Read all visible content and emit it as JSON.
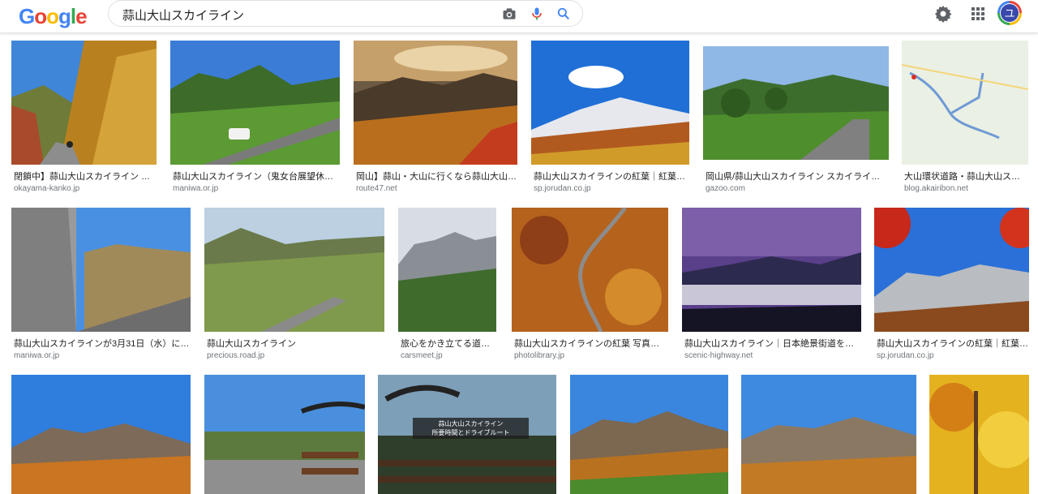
{
  "header": {
    "logo_letters": [
      "G",
      "o",
      "o",
      "g",
      "l",
      "e"
    ],
    "search_query": "蒜山大山スカイライン",
    "avatar_initial": "ユ",
    "icons": [
      "camera-icon",
      "mic-icon",
      "search-icon",
      "gear-icon",
      "apps-icon"
    ]
  },
  "colors": {
    "blue": "#4285f4",
    "red": "#ea4335",
    "yellow": "#fbbc05",
    "green": "#34a853"
  },
  "results": [
    {
      "title": "閉鎖中】蒜山大山スカイライン ｜ ...",
      "site": "okayama-kanko.jp",
      "scene": "autumn-road"
    },
    {
      "title": "蒜山大山スカイライン（鬼女台展望休憩...",
      "site": "maniwa.or.jp",
      "scene": "green-hills"
    },
    {
      "title": "岡山】蒜山・大山に行くなら蒜山大山ス...",
      "site": "route47.net",
      "scene": "sunset-mountains"
    },
    {
      "title": "蒜山大山スカイラインの紅葉｜紅葉情...",
      "site": "sp.jorudan.co.jp",
      "scene": "snow-peak"
    },
    {
      "title": "岡山県/蒜山大山スカイライン スカイライン特...",
      "site": "gazoo.com",
      "scene": "green-road"
    },
    {
      "title": "大山環状道路・蒜山大山スカ...",
      "site": "blog.akairibon.net",
      "scene": "map"
    },
    {
      "title": "蒜山大山スカイラインが3月31日（水）に開...",
      "site": "maniwa.or.jp",
      "scene": "stone-monument"
    },
    {
      "title": "蒜山大山スカイライン",
      "site": "precious.road.jp",
      "scene": "hill-road"
    },
    {
      "title": "旅心をかき立てる道。...",
      "site": "carsmeet.jp",
      "scene": "ridge"
    },
    {
      "title": "蒜山大山スカイラインの紅葉 写真素材...",
      "site": "photolibrary.jp",
      "scene": "aerial-forest"
    },
    {
      "title": "蒜山大山スカイライン｜日本絶景街道を走る...",
      "site": "scenic-highway.net",
      "scene": "sea-of-clouds"
    },
    {
      "title": "蒜山大山スカイラインの紅葉｜紅葉情...",
      "site": "sp.jorudan.co.jp",
      "scene": "red-maple"
    },
    {
      "title": "",
      "site": "",
      "scene": "autumn-peaks"
    },
    {
      "title": "",
      "site": "",
      "scene": "terrace-umbrella"
    },
    {
      "title": "",
      "site": "",
      "scene": "terrace-banner",
      "banner_title": "蒜山大山スカイライン",
      "banner_sub": "所要時間とドライブルート"
    },
    {
      "title": "",
      "site": "",
      "scene": "autumn-peaks-2"
    },
    {
      "title": "",
      "site": "",
      "scene": "autumn-peaks-3"
    },
    {
      "title": "",
      "site": "",
      "scene": "yellow-forest"
    }
  ]
}
